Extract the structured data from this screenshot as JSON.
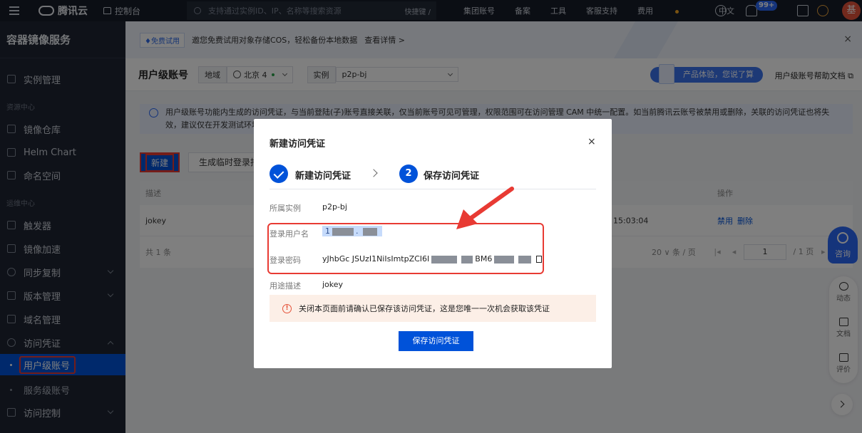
{
  "topbar": {
    "brand": "腾讯云",
    "console": "控制台",
    "search_placeholder": "支持通过实例ID、IP、名称等搜索资源",
    "shortcut": "快捷键 /",
    "links": [
      "集团账号",
      "备案",
      "工具",
      "客服支持",
      "费用",
      "中文"
    ],
    "badge": "99+",
    "avatar": "基"
  },
  "sidebar": {
    "title": "容器镜像服务",
    "items": {
      "instances": "实例管理",
      "group_resource": "资源中心",
      "repos": "镜像仓库",
      "helm": "Helm Chart",
      "namespace": "命名空间",
      "group_ops": "运维中心",
      "trigger": "触发器",
      "accel": "镜像加速",
      "sync": "同步复制",
      "version": "版本管理",
      "domain": "域名管理",
      "credential": "访问凭证",
      "user_account": "用户级账号",
      "service_account": "服务级账号",
      "access_control": "访问控制"
    }
  },
  "banner": {
    "tag": "♦免费试用",
    "message": "邀您免费试用对象存储COS，轻松备份本地数据",
    "more": "查看详情 >",
    "close": "×"
  },
  "header": {
    "title": "用户级账号",
    "region_label": "地域",
    "region_value": "北京 4",
    "instance_label": "实例",
    "instance_value": "p2p-bj",
    "feedback": "产品体验，您说了算",
    "help": "用户级账号帮助文档 ⧉"
  },
  "notice": {
    "line1": "用户级账号功能内生成的访问凭证，与当前登陆(子)账号直接关联，仅当前账号可见可管理，权限范围可在访问管理 CAM 中统一配置。如当前腾讯云账号被禁用或删除，关联的访问凭证也将失",
    "line2": "效，建议仅在开发测试环境"
  },
  "toolbar": {
    "new": "新建",
    "temp": "生成临时登录指令"
  },
  "table": {
    "col_desc": "描述",
    "col_ops": "操作",
    "row_desc": "jokey",
    "row_time": "15:03:04",
    "row_disable": "禁用",
    "row_delete": "删除",
    "total": "共 1 条",
    "page_size": "20 ∨ 条 / 页",
    "page_first": "|◂",
    "page_prev": "◂",
    "page_current": "1",
    "page_total": "/ 1 页",
    "page_next": "▸"
  },
  "float": {
    "consult": "咨询",
    "dynamic": "动态",
    "docs": "文档",
    "review": "评价"
  },
  "modal": {
    "title": "新建访问凭证",
    "close": "×",
    "step1": "新建访问凭证",
    "step2_num": "2",
    "step2": "保存访问凭证",
    "instance_label": "所属实例",
    "instance_value": "p2p-bj",
    "username_label": "登录用户名",
    "username_prefix": "1",
    "password_label": "登录密码",
    "password_visible": "yJhbGc  JSUzI1NiIsImtpZCI6I",
    "password_mid": "BM6",
    "desc_label": "用途描述",
    "desc_value": "jokey",
    "warning": "关闭本页面前请确认已保存该访问凭证，这是您唯一一次机会获取该凭证",
    "save_button": "保存访问凭证"
  },
  "colors": {
    "primary": "#0052d9",
    "annotation_red": "#e83a33",
    "sidebar_bg": "#1f2532",
    "topbar_bg": "#171d28"
  }
}
